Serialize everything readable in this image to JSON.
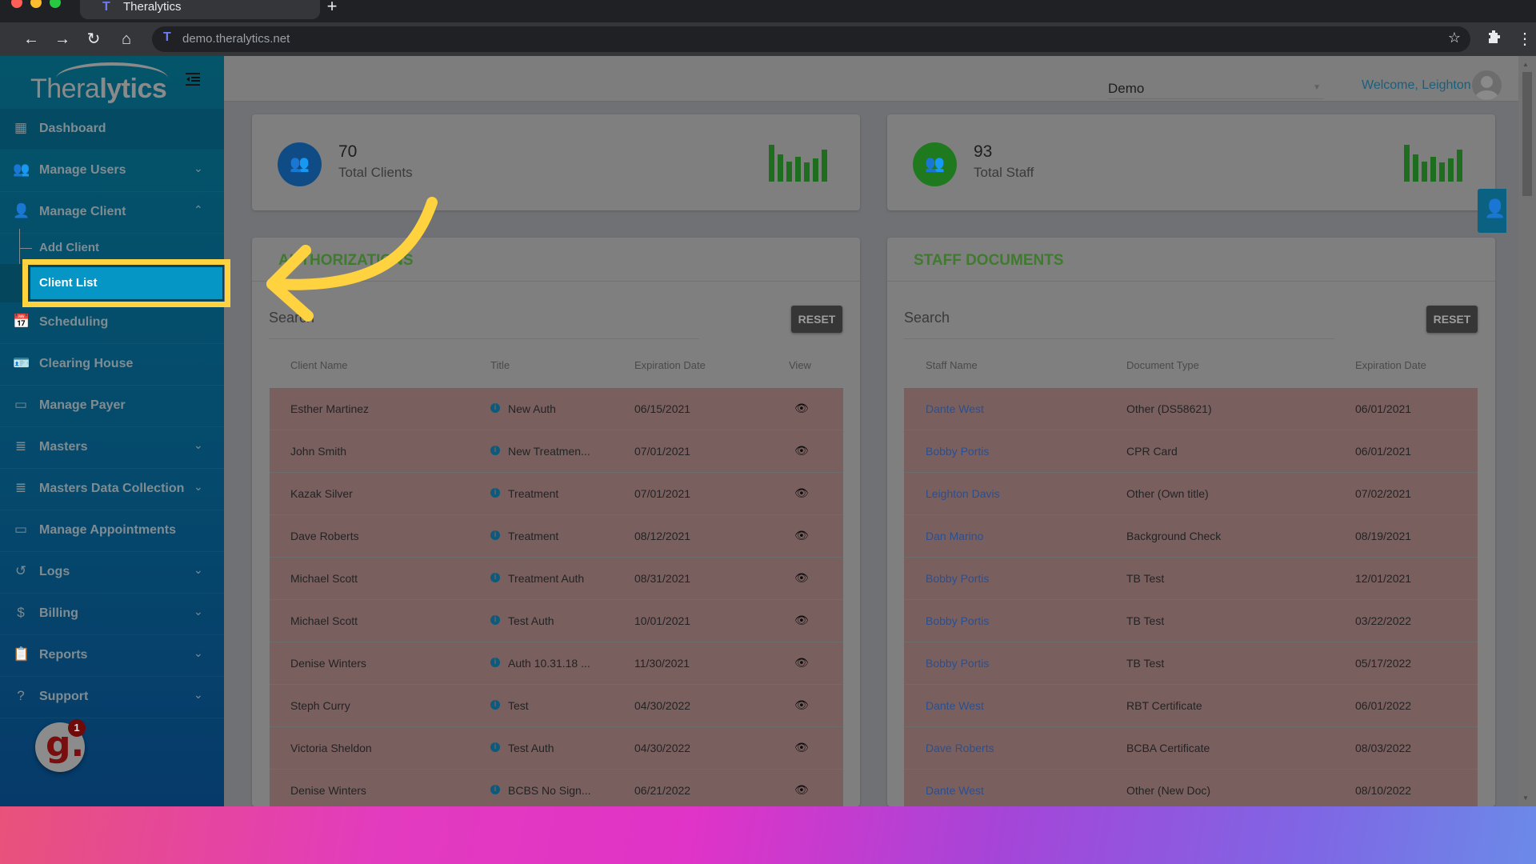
{
  "browser": {
    "tab_title": "Theralytics",
    "new_tab_symbol": "+",
    "url": "demo.theralytics.net",
    "icons": {
      "back": "←",
      "forward": "→",
      "reload": "↻",
      "home": "⌂",
      "favicon": "T",
      "bookmark_star": "☆",
      "extensions": "puzzle-icon",
      "menu": "⋮"
    },
    "traffic_lights": [
      "#ff5f57",
      "#febc2e",
      "#28c840"
    ]
  },
  "app": {
    "logo_text_light": "Thera",
    "logo_text_bold": "lytics",
    "collapse_icon": "☰"
  },
  "sidebar": {
    "items": [
      {
        "label": "Dashboard",
        "icon": "dashboard-icon",
        "glyph": "▦",
        "chevron": ""
      },
      {
        "label": "Manage Users",
        "icon": "users-icon",
        "glyph": "👥",
        "chevron": "⌄"
      },
      {
        "label": "Manage Client",
        "icon": "person-icon",
        "glyph": "👤",
        "chevron": "⌃"
      },
      {
        "label": "Scheduling",
        "icon": "calendar-icon",
        "glyph": "📅",
        "chevron": ""
      },
      {
        "label": "Clearing House",
        "icon": "id-card-icon",
        "glyph": "🪪",
        "chevron": ""
      },
      {
        "label": "Manage Payer",
        "icon": "payer-icon",
        "glyph": "▭",
        "chevron": ""
      },
      {
        "label": "Masters",
        "icon": "database-icon",
        "glyph": "≣",
        "chevron": "⌄"
      },
      {
        "label": "Masters Data Collection",
        "icon": "database-icon",
        "glyph": "≣",
        "chevron": "⌄"
      },
      {
        "label": "Manage Appointments",
        "icon": "appointments-icon",
        "glyph": "▭",
        "chevron": ""
      },
      {
        "label": "Logs",
        "icon": "history-icon",
        "glyph": "↺",
        "chevron": "⌄"
      },
      {
        "label": "Billing",
        "icon": "dollar-icon",
        "glyph": "$",
        "chevron": "⌄"
      },
      {
        "label": "Reports",
        "icon": "clipboard-icon",
        "glyph": "📋",
        "chevron": "⌄"
      },
      {
        "label": "Support",
        "icon": "help-icon",
        "glyph": "?",
        "chevron": "⌄"
      }
    ],
    "sub_items": [
      {
        "label": "Add Client"
      },
      {
        "label": "Client List",
        "active": true
      }
    ],
    "widget": {
      "letter": "g.",
      "badge": "1"
    }
  },
  "header": {
    "org_select_value": "Demo",
    "org_select_arrow": "▼",
    "welcome": "Welcome, Leighton"
  },
  "stats": [
    {
      "value": "70",
      "label": "Total Clients",
      "color": "#0f4c86",
      "spark": [
        1.0,
        0.74,
        0.55,
        0.68,
        0.52,
        0.62,
        0.87
      ]
    },
    {
      "value": "93",
      "label": "Total Staff",
      "color": "#1f7a1f",
      "spark": [
        1.0,
        0.74,
        0.55,
        0.68,
        0.52,
        0.62,
        0.87
      ]
    }
  ],
  "authorizations": {
    "title": "AUTHORIZATIONS",
    "search_placeholder": "Search",
    "reset_label": "RESET",
    "columns": [
      "Client Name",
      "Title",
      "Expiration Date",
      "View"
    ],
    "rows": [
      {
        "client": "Esther Martinez",
        "title": "New Auth",
        "expires": "06/15/2021"
      },
      {
        "client": "John Smith",
        "title": "New Treatmen...",
        "expires": "07/01/2021"
      },
      {
        "client": "Kazak Silver",
        "title": "Treatment",
        "expires": "07/01/2021"
      },
      {
        "client": "Dave Roberts",
        "title": "Treatment",
        "expires": "08/12/2021"
      },
      {
        "client": "Michael Scott",
        "title": "Treatment Auth",
        "expires": "08/31/2021"
      },
      {
        "client": "Michael Scott",
        "title": "Test Auth",
        "expires": "10/01/2021"
      },
      {
        "client": "Denise Winters",
        "title": "Auth 10.31.18 ...",
        "expires": "11/30/2021"
      },
      {
        "client": "Steph Curry",
        "title": "Test",
        "expires": "04/30/2022"
      },
      {
        "client": "Victoria Sheldon",
        "title": "Test Auth",
        "expires": "04/30/2022"
      },
      {
        "client": "Denise Winters",
        "title": "BCBS No Sign...",
        "expires": "06/21/2022"
      }
    ]
  },
  "staff_documents": {
    "title": "STAFF DOCUMENTS",
    "search_placeholder": "Search",
    "reset_label": "RESET",
    "columns": [
      "Staff Name",
      "Document Type",
      "Expiration Date"
    ],
    "rows": [
      {
        "staff": "Dante West",
        "doc": "Other (DS58621)",
        "expires": "06/01/2021"
      },
      {
        "staff": "Bobby Portis",
        "doc": "CPR Card",
        "expires": "06/01/2021"
      },
      {
        "staff": "Leighton Davis",
        "doc": "Other (Own title)",
        "expires": "07/02/2021"
      },
      {
        "staff": "Dan Marino",
        "doc": "Background Check",
        "expires": "08/19/2021"
      },
      {
        "staff": "Bobby Portis",
        "doc": "TB Test",
        "expires": "12/01/2021"
      },
      {
        "staff": "Bobby Portis",
        "doc": "TB Test",
        "expires": "03/22/2022"
      },
      {
        "staff": "Bobby Portis",
        "doc": "TB Test",
        "expires": "05/17/2022"
      },
      {
        "staff": "Dante West",
        "doc": "RBT Certificate",
        "expires": "06/01/2022"
      },
      {
        "staff": "Dave Roberts",
        "doc": "BCBA Certificate",
        "expires": "08/03/2022"
      },
      {
        "staff": "Dante West",
        "doc": "Other (New Doc)",
        "expires": "08/10/2022"
      }
    ]
  },
  "colors": {
    "highlight": "#ffd23f",
    "active_nav": "#0696c6",
    "panel_title": "#3f7a2e",
    "expired_row": "#7a5f5f",
    "link": "#2b4f8e"
  }
}
